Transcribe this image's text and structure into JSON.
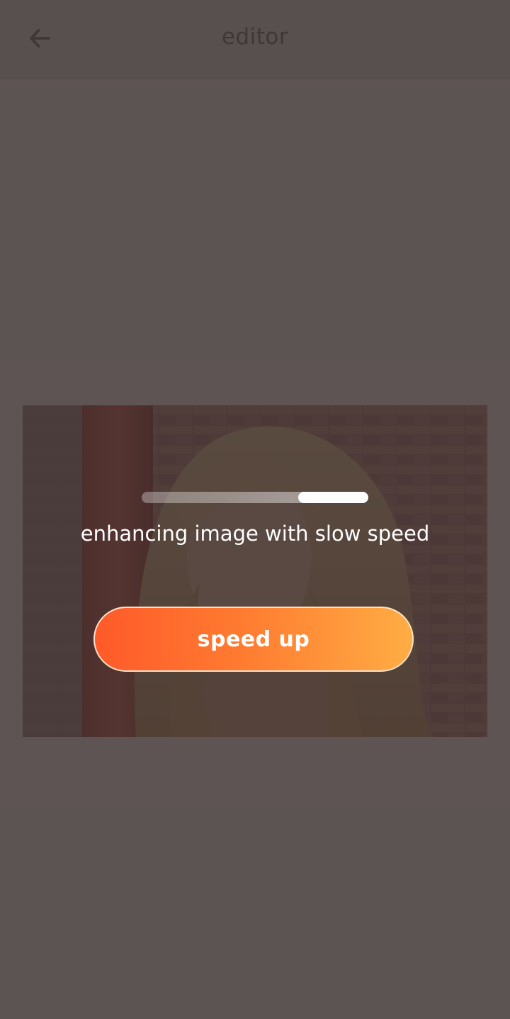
{
  "header": {
    "title": "editor",
    "back_icon": "arrow-left-icon"
  },
  "photo": {
    "subject": "portrait-photo"
  },
  "progress": {
    "fill_start": 0.69,
    "fill_end": 1.0
  },
  "status": {
    "message": "enhancing image with slow speed"
  },
  "actions": {
    "speed_up_label": "speed up"
  },
  "colors": {
    "accent_start": "#ff5a2a",
    "accent_end": "#ffad44",
    "scrim": "#3a302e"
  }
}
